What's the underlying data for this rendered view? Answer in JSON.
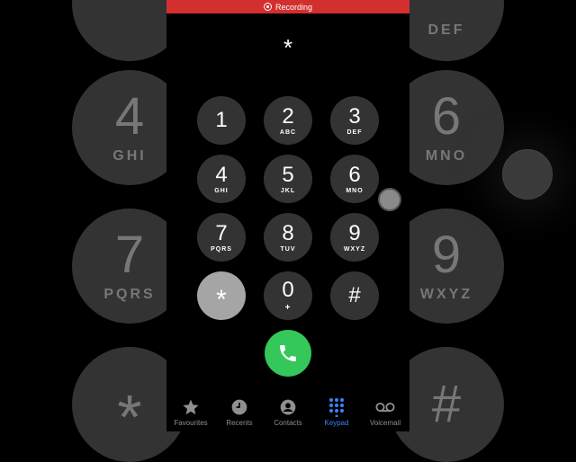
{
  "status_bar": {
    "recording_label": "Recording"
  },
  "dialer": {
    "entered": "*"
  },
  "keypad": [
    {
      "digit": "1",
      "letters": ""
    },
    {
      "digit": "2",
      "letters": "ABC"
    },
    {
      "digit": "3",
      "letters": "DEF"
    },
    {
      "digit": "4",
      "letters": "GHI"
    },
    {
      "digit": "5",
      "letters": "JKL"
    },
    {
      "digit": "6",
      "letters": "MNO"
    },
    {
      "digit": "7",
      "letters": "PQRS"
    },
    {
      "digit": "8",
      "letters": "TUV"
    },
    {
      "digit": "9",
      "letters": "WXYZ"
    },
    {
      "digit": "*",
      "letters": ""
    },
    {
      "digit": "0",
      "letters": "+"
    },
    {
      "digit": "#",
      "letters": ""
    }
  ],
  "background_zoom": [
    {
      "digit": "",
      "letters": "DEF"
    },
    {
      "digit": "4",
      "letters": "GHI"
    },
    {
      "digit": "6",
      "letters": "MNO"
    },
    {
      "digit": "7",
      "letters": "PQRS"
    },
    {
      "digit": "9",
      "letters": "WXYZ"
    },
    {
      "digit": "*",
      "letters": ""
    },
    {
      "digit": "#",
      "letters": ""
    }
  ],
  "tab_bar": [
    {
      "label": "Favourites",
      "icon": "star-icon"
    },
    {
      "label": "Recents",
      "icon": "clock-icon"
    },
    {
      "label": "Contacts",
      "icon": "person-icon"
    },
    {
      "label": "Keypad",
      "icon": "keypad-icon",
      "active": true
    },
    {
      "label": "Voicemail",
      "icon": "voicemail-icon"
    }
  ],
  "colors": {
    "recording": "#d32f2f",
    "call": "#34c759",
    "active_tab": "#3b82f6"
  }
}
